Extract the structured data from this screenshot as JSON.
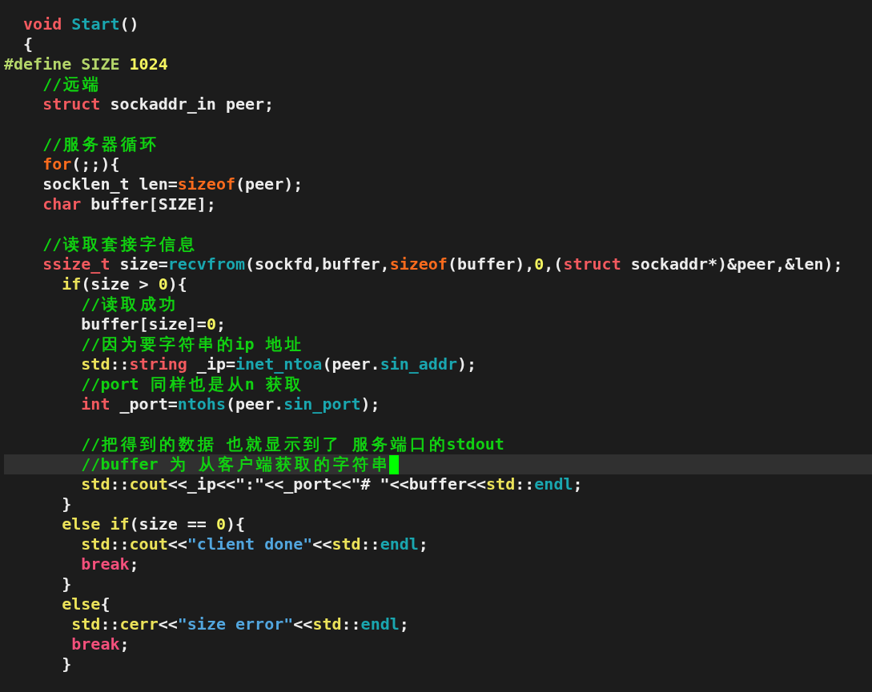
{
  "editor": {
    "lines": [
      {
        "current": false,
        "tokens": [
          {
            "kind": "type",
            "text": "  void "
          },
          {
            "kind": "func",
            "text": "Start"
          },
          {
            "kind": "plain",
            "text": "()"
          }
        ]
      },
      {
        "current": false,
        "tokens": [
          {
            "kind": "plain",
            "text": "  {"
          }
        ]
      },
      {
        "current": false,
        "tokens": [
          {
            "kind": "preproc",
            "text": "#define SIZE "
          },
          {
            "kind": "number",
            "text": "1024"
          }
        ]
      },
      {
        "current": false,
        "tokens": [
          {
            "kind": "comment",
            "text": "    //远端"
          }
        ]
      },
      {
        "current": false,
        "tokens": [
          {
            "kind": "type",
            "text": "    struct"
          },
          {
            "kind": "plain",
            "text": " sockaddr_in peer;"
          }
        ]
      },
      {
        "current": false
      },
      {
        "current": false,
        "tokens": [
          {
            "kind": "comment",
            "text": "    //服务器循环"
          }
        ]
      },
      {
        "current": false,
        "tokens": [
          {
            "kind": "loop",
            "text": "    for"
          },
          {
            "kind": "plain",
            "text": "(;;){"
          }
        ]
      },
      {
        "current": false,
        "tokens": [
          {
            "kind": "plain",
            "text": "    socklen_t len="
          },
          {
            "kind": "loop",
            "text": "sizeof"
          },
          {
            "kind": "plain",
            "text": "(peer);"
          }
        ]
      },
      {
        "current": false,
        "tokens": [
          {
            "kind": "type",
            "text": "    char"
          },
          {
            "kind": "plain",
            "text": " buffer[SIZE];"
          }
        ]
      },
      {
        "current": false
      },
      {
        "current": false,
        "tokens": [
          {
            "kind": "comment",
            "text": "    //读取套接字信息"
          }
        ]
      },
      {
        "current": false,
        "tokens": [
          {
            "kind": "type",
            "text": "    ssize_t"
          },
          {
            "kind": "plain",
            "text": " size="
          },
          {
            "kind": "func",
            "text": "recvfrom"
          },
          {
            "kind": "plain",
            "text": "(sockfd,buffer,"
          },
          {
            "kind": "loop",
            "text": "sizeof"
          },
          {
            "kind": "plain",
            "text": "(buffer),"
          },
          {
            "kind": "number",
            "text": "0"
          },
          {
            "kind": "plain",
            "text": ",("
          },
          {
            "kind": "type",
            "text": "struct"
          },
          {
            "kind": "plain",
            "text": " sockaddr*)&peer,&len);"
          }
        ]
      },
      {
        "current": false,
        "tokens": [
          {
            "kind": "statement",
            "text": "      if"
          },
          {
            "kind": "plain",
            "text": "(size > "
          },
          {
            "kind": "number",
            "text": "0"
          },
          {
            "kind": "plain",
            "text": "){"
          }
        ]
      },
      {
        "current": false,
        "tokens": [
          {
            "kind": "comment",
            "text": "        //读取成功"
          }
        ]
      },
      {
        "current": false,
        "tokens": [
          {
            "kind": "plain",
            "text": "        buffer[size]="
          },
          {
            "kind": "number",
            "text": "0"
          },
          {
            "kind": "plain",
            "text": ";"
          }
        ]
      },
      {
        "current": false,
        "tokens": [
          {
            "kind": "comment",
            "text": "        //因为要字符串的ip 地址"
          }
        ]
      },
      {
        "current": false,
        "tokens": [
          {
            "kind": "statement",
            "text": "        std"
          },
          {
            "kind": "plain",
            "text": "::"
          },
          {
            "kind": "type",
            "text": "string"
          },
          {
            "kind": "plain",
            "text": " _ip="
          },
          {
            "kind": "func",
            "text": "inet_ntoa"
          },
          {
            "kind": "plain",
            "text": "(peer."
          },
          {
            "kind": "func",
            "text": "sin_addr"
          },
          {
            "kind": "plain",
            "text": ");"
          }
        ]
      },
      {
        "current": false,
        "tokens": [
          {
            "kind": "comment",
            "text": "        //port 同样也是从n 获取"
          }
        ]
      },
      {
        "current": false,
        "tokens": [
          {
            "kind": "type",
            "text": "        int"
          },
          {
            "kind": "plain",
            "text": " _port="
          },
          {
            "kind": "func",
            "text": "ntohs"
          },
          {
            "kind": "plain",
            "text": "(peer."
          },
          {
            "kind": "func",
            "text": "sin_port"
          },
          {
            "kind": "plain",
            "text": ");"
          }
        ]
      },
      {
        "current": false
      },
      {
        "current": false,
        "tokens": [
          {
            "kind": "comment",
            "text": "        //把得到的数据 也就显示到了 服务端口的stdout"
          }
        ]
      },
      {
        "current": true,
        "tokens": [
          {
            "kind": "comment",
            "text": "        //buffer 为 从客户端获取的字符串"
          }
        ]
      },
      {
        "current": false,
        "tokens": [
          {
            "kind": "statement",
            "text": "        std"
          },
          {
            "kind": "plain",
            "text": "::"
          },
          {
            "kind": "statement",
            "text": "cout"
          },
          {
            "kind": "plain",
            "text": "<<_ip<<\":\"<<_port<<\"# \"<<buffer<<"
          },
          {
            "kind": "statement",
            "text": "std"
          },
          {
            "kind": "plain",
            "text": "::"
          },
          {
            "kind": "func",
            "text": "endl"
          },
          {
            "kind": "plain",
            "text": ";"
          }
        ]
      },
      {
        "current": false,
        "tokens": [
          {
            "kind": "plain",
            "text": "      }"
          }
        ]
      },
      {
        "current": false,
        "tokens": [
          {
            "kind": "statement",
            "text": "      else if"
          },
          {
            "kind": "plain",
            "text": "(size == "
          },
          {
            "kind": "number",
            "text": "0"
          },
          {
            "kind": "plain",
            "text": "){"
          }
        ]
      },
      {
        "current": false,
        "tokens": [
          {
            "kind": "statement",
            "text": "        std"
          },
          {
            "kind": "plain",
            "text": "::"
          },
          {
            "kind": "statement",
            "text": "cout"
          },
          {
            "kind": "plain",
            "text": "<<"
          },
          {
            "kind": "string",
            "text": "\"client done\""
          },
          {
            "kind": "plain",
            "text": "<<"
          },
          {
            "kind": "statement",
            "text": "std"
          },
          {
            "kind": "plain",
            "text": "::"
          },
          {
            "kind": "func",
            "text": "endl"
          },
          {
            "kind": "plain",
            "text": ";"
          }
        ]
      },
      {
        "current": false,
        "tokens": [
          {
            "kind": "jump",
            "text": "        break"
          },
          {
            "kind": "plain",
            "text": ";"
          }
        ]
      },
      {
        "current": false,
        "tokens": [
          {
            "kind": "plain",
            "text": "      }"
          }
        ]
      },
      {
        "current": false,
        "tokens": [
          {
            "kind": "statement",
            "text": "      else"
          },
          {
            "kind": "plain",
            "text": "{"
          }
        ]
      },
      {
        "current": false,
        "tokens": [
          {
            "kind": "statement",
            "text": "       std"
          },
          {
            "kind": "plain",
            "text": "::"
          },
          {
            "kind": "statement",
            "text": "cerr"
          },
          {
            "kind": "plain",
            "text": "<<"
          },
          {
            "kind": "string",
            "text": "\"size error\""
          },
          {
            "kind": "plain",
            "text": "<<"
          },
          {
            "kind": "statement",
            "text": "std"
          },
          {
            "kind": "plain",
            "text": "::"
          },
          {
            "kind": "func",
            "text": "endl"
          },
          {
            "kind": "plain",
            "text": ";"
          }
        ]
      },
      {
        "current": false,
        "tokens": [
          {
            "kind": "jump",
            "text": "       break"
          },
          {
            "kind": "plain",
            "text": ";"
          }
        ]
      },
      {
        "current": false,
        "tokens": [
          {
            "kind": "plain",
            "text": "      }"
          }
        ]
      }
    ]
  }
}
